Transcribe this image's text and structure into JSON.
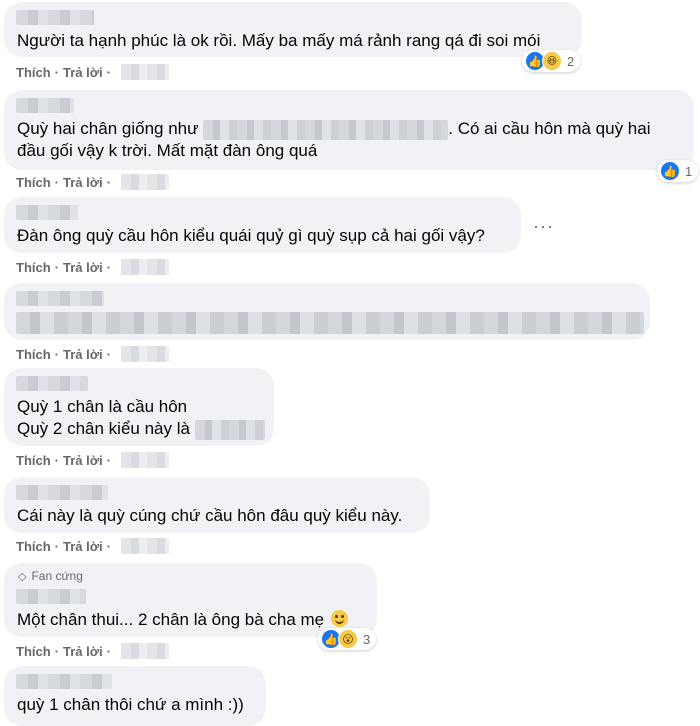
{
  "actions": {
    "like_label": "Thích",
    "reply_label": "Trả lời",
    "separator": "·"
  },
  "comments": [
    {
      "lines": [
        "Người ta hạnh phúc là ok rồi. Mấy ba mấy má rảnh rang qá đi soi mói"
      ],
      "reactions": {
        "icons": [
          "like-icon",
          "haha-icon"
        ],
        "count": "2"
      }
    },
    {
      "lines": [
        "Quỳ hai chân giống như",
        ". Có ai cầu hôn mà quỳ hai",
        "đầu gối vậy k trời. Mất mặt đàn ông quá"
      ],
      "reactions": {
        "icons": [
          "like-icon"
        ],
        "count": "1"
      }
    },
    {
      "lines": [
        "Đàn ông quỳ cầu hôn kiểu quái quỷ gì quỳ sụp cả hai gối vậy?"
      ],
      "more": "···"
    },
    {
      "lines": []
    },
    {
      "lines": [
        "Quỳ 1 chân là cầu hôn",
        "Quỳ 2 chân kiểu này là"
      ]
    },
    {
      "lines": [
        "Cái này là quỳ cúng chứ cầu hôn đâu quỳ kiểu này."
      ]
    },
    {
      "badge": {
        "icon": "diamond-icon",
        "label": "Fan cứng"
      },
      "lines": [
        "Một chân thui... 2 chân là ông bà cha mẹ"
      ],
      "reactions": {
        "icons": [
          "like-icon",
          "wow-icon"
        ],
        "count": "3"
      }
    },
    {
      "lines": [
        "quỳ 1 chân thôi chứ a mình :))"
      ]
    }
  ],
  "colors": {
    "bubble": "#f0f2f5",
    "meta_text": "#65676b",
    "like_blue": "#1877f2",
    "emoji_yellow": "#f7c948"
  }
}
